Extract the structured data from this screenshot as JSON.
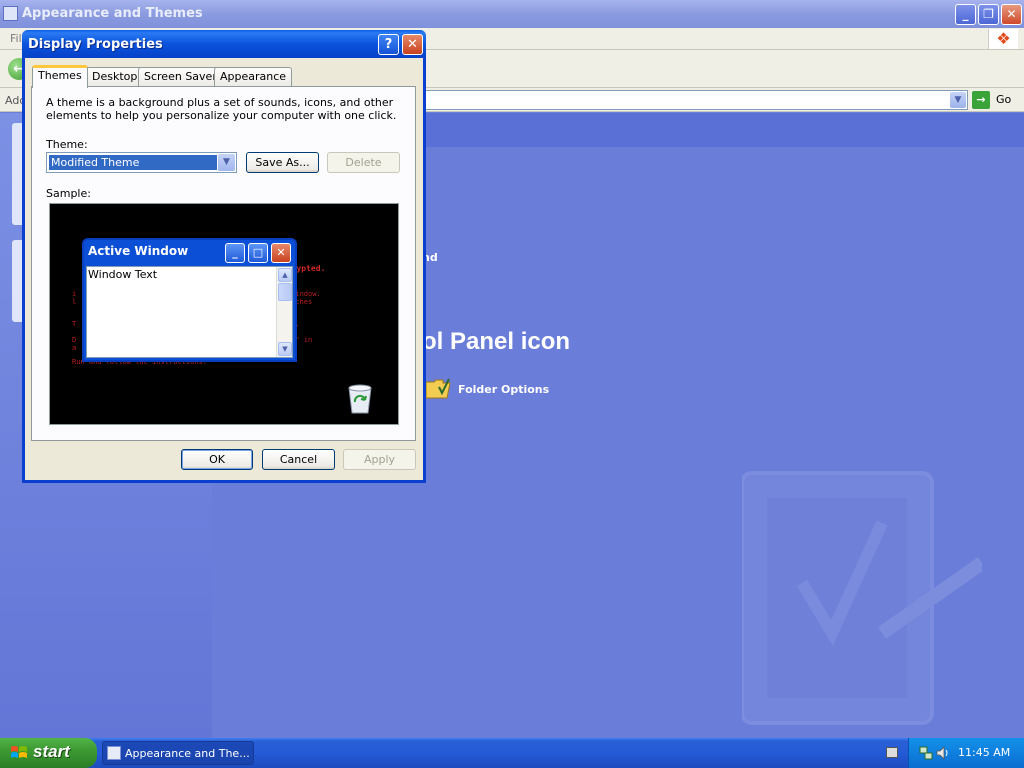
{
  "explorer": {
    "title": "Appearance and Themes",
    "menu_first": "File",
    "address_label": "Address",
    "go_label": "Go",
    "main_text_1": "nd",
    "heading": "ol Panel icon",
    "folder_options_label": "Folder Options"
  },
  "dialog": {
    "title": "Display Properties",
    "tabs": [
      {
        "label": "Themes",
        "active": true
      },
      {
        "label": "Desktop",
        "active": false
      },
      {
        "label": "Screen Saver",
        "active": false
      },
      {
        "label": "Appearance",
        "active": false
      }
    ],
    "description": "A theme is a background plus a set of sounds, icons, and other elements to help you personalize your computer with one click.",
    "theme_label": "Theme:",
    "theme_value": "Modified Theme",
    "save_as_label": "Save As...",
    "delete_label": "Delete",
    "sample_label": "Sample:",
    "sample_window": {
      "title": "Active Window",
      "text": "Window Text"
    },
    "ok_label": "OK",
    "cancel_label": "Cancel",
    "apply_label": "Apply"
  },
  "taskbar": {
    "start_label": "start",
    "task_label": "Appearance and The...",
    "clock": "11:45 AM"
  },
  "colors": {
    "desktop_blue": "#6b7fd8",
    "dialog_title_blue": "#0a53dd",
    "taskbar_blue": "#245bd6",
    "start_green": "#3d9a33",
    "selection_blue": "#316ac5",
    "sample_text_red": "#b82020"
  }
}
